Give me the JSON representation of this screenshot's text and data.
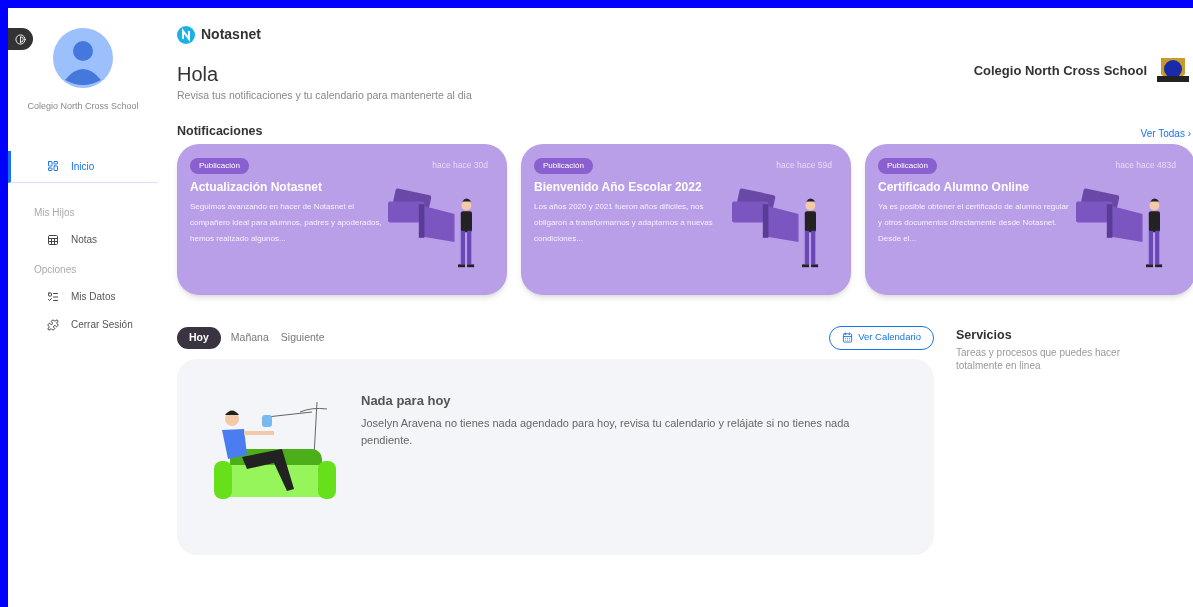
{
  "sidebar": {
    "school": "Colegio North Cross School",
    "sections": [
      {
        "items": [
          {
            "label": "Inicio",
            "selected": true
          }
        ]
      },
      {
        "title": "Mis Hijos",
        "items": [
          {
            "label": "Notas",
            "selected": false
          }
        ]
      },
      {
        "title": "Opciones",
        "items": [
          {
            "label": "Mis Datos",
            "selected": false
          },
          {
            "label": "Cerrar Sesión",
            "selected": false
          }
        ]
      }
    ]
  },
  "header": {
    "brand": "Notasnet",
    "greeting": "Hola",
    "subtitle": "Revisa tus notificaciones y tu calendario para mantenerte al dia",
    "school": "Colegio North Cross School"
  },
  "notifications": {
    "title": "Notificaciones",
    "link": "Ver Todas ›",
    "cards": [
      {
        "tag": "Publicación",
        "time": "hace hace 30d",
        "title": "Actualización Notasnet",
        "body": "Seguimos avanzando en hacer de Notasnet el compañero ideal para alumnos, padres y apoderados, hemos realizado algunos..."
      },
      {
        "tag": "Publicación",
        "time": "hace hace 59d",
        "title": "Bienvenido Año Escolar 2022",
        "body": "Los años 2020 y 2021 fueron años difíciles, nos obligaron a transformarnos y adaptarnos a nuevas condiciones..."
      },
      {
        "tag": "Publicación",
        "time": "hace hace 483d",
        "title": "Certificado Alumno Online",
        "body": "Ya es posible obtener el certificado de alumno regular y otros documentos directamente desde Notasnet. Desde el..."
      }
    ]
  },
  "agenda": {
    "tabs": [
      {
        "label": "Hoy",
        "selected": true
      },
      {
        "label": "Mañana",
        "selected": false
      },
      {
        "label": "Siguiente",
        "selected": false
      }
    ],
    "calendar_button": "Ver Calendario",
    "empty": {
      "title": "Nada para hoy",
      "body": "Joselyn Aravena no tienes nada agendado para hoy, revisa tu calendario y relájate si no tienes nada pendiente."
    }
  },
  "services": {
    "title": "Servicios",
    "subtitle": "Tareas y procesos que puedes hacer totalmente en linea"
  }
}
